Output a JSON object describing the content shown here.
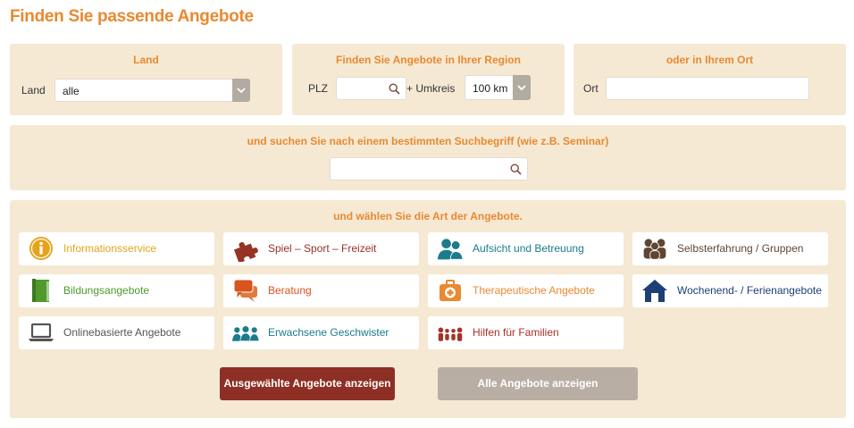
{
  "page_title": "Finden Sie passende Angebote",
  "land": {
    "heading": "Land",
    "label": "Land",
    "value": "alle"
  },
  "region": {
    "heading": "Finden Sie Angebote in Ihrer Region",
    "plz_label": "PLZ",
    "plz_value": "",
    "umkreis_label": "+ Umkreis",
    "umkreis_value": "100 km"
  },
  "ort": {
    "heading": "oder in Ihrem Ort",
    "label": "Ort",
    "value": ""
  },
  "search": {
    "heading": "und suchen Sie nach einem bestimmten Suchbegriff (wie z.B. Seminar)",
    "value": ""
  },
  "categories": {
    "heading": "und wählen Sie die Art der Angebote.",
    "items": [
      {
        "label": "Informationsservice",
        "icon": "info-icon",
        "color": "#e5a31b"
      },
      {
        "label": "Spiel – Sport – Freizeit",
        "icon": "puzzle-icon",
        "color": "#963325"
      },
      {
        "label": "Aufsicht und Betreuung",
        "icon": "people-icon",
        "color": "#1a7c8d"
      },
      {
        "label": "Selbsterfahrung / Gruppen",
        "icon": "group-icon",
        "color": "#5f4633"
      },
      {
        "label": "Bildungsangebote",
        "icon": "book-icon",
        "color": "#4f9a2a"
      },
      {
        "label": "Beratung",
        "icon": "speech-bubbles-icon",
        "color": "#d9541e"
      },
      {
        "label": "Therapeutische Angebote",
        "icon": "medical-kit-icon",
        "color": "#e98930"
      },
      {
        "label": "Wochenend- / Ferienangebote",
        "icon": "house-icon",
        "color": "#1d3f73"
      },
      {
        "label": "Onlinebasierte Angebote",
        "icon": "laptop-icon",
        "color": "#555555"
      },
      {
        "label": "Erwachsene Geschwister",
        "icon": "adults-group-icon",
        "color": "#1a7c8d"
      },
      {
        "label": "Hilfen für Familien",
        "icon": "family-icon",
        "color": "#a43228"
      }
    ]
  },
  "buttons": {
    "selected": "Ausgewählte Angebote anzeigen",
    "all": "Alle Angebote anzeigen"
  }
}
